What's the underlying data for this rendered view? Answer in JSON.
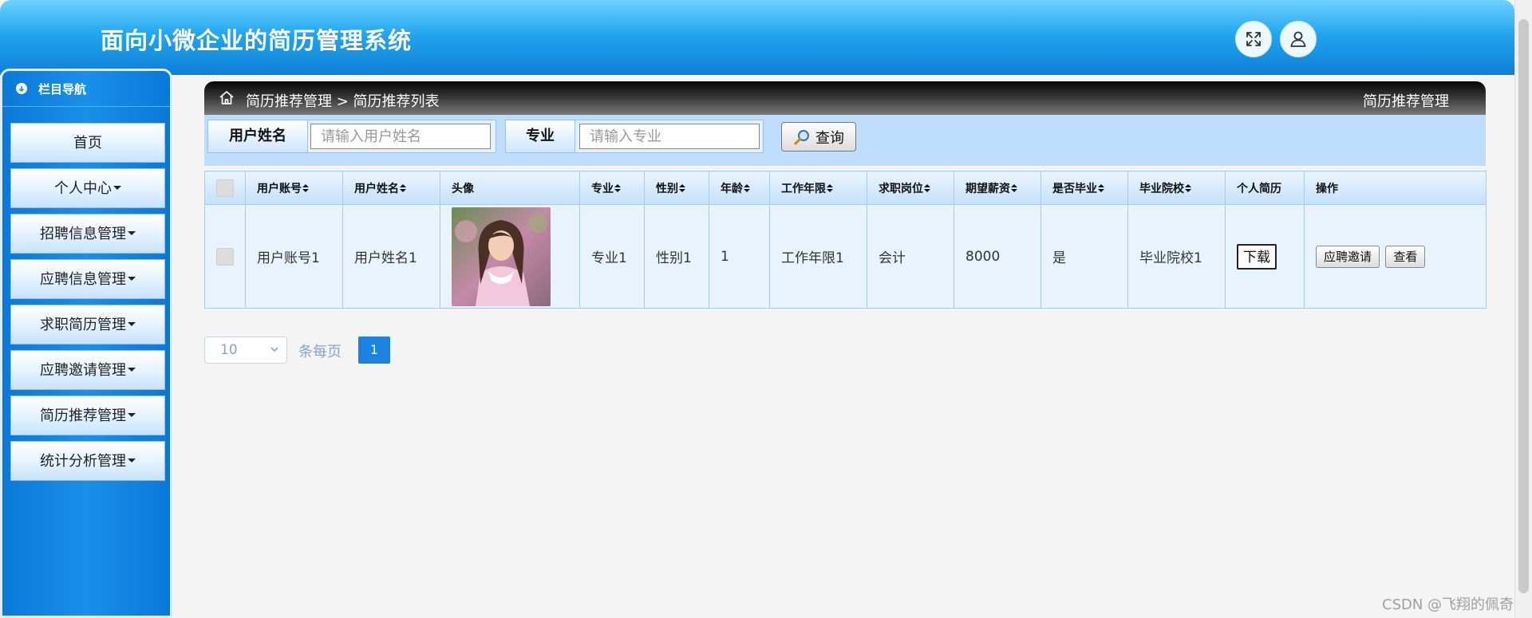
{
  "header": {
    "title": "面向小微企业的简历管理系统",
    "fullscreen_icon": "expand-icon",
    "user_icon": "user-icon"
  },
  "sidebar": {
    "nav_title": "栏目导航",
    "items": [
      {
        "label": "首页",
        "has_caret": false
      },
      {
        "label": "个人中心",
        "has_caret": true
      },
      {
        "label": "招聘信息管理",
        "has_caret": true
      },
      {
        "label": "应聘信息管理",
        "has_caret": true
      },
      {
        "label": "求职简历管理",
        "has_caret": true
      },
      {
        "label": "应聘邀请管理",
        "has_caret": true
      },
      {
        "label": "简历推荐管理",
        "has_caret": true
      },
      {
        "label": "统计分析管理",
        "has_caret": true
      }
    ]
  },
  "breadcrumb": {
    "path": "简历推荐管理 > 简历推荐列表",
    "right_title": "简历推荐管理"
  },
  "search": {
    "username_label": "用户姓名",
    "username_placeholder": "请输入用户姓名",
    "major_label": "专业",
    "major_placeholder": "请输入专业",
    "button_label": "查询"
  },
  "table": {
    "columns": [
      "用户账号",
      "用户姓名",
      "头像",
      "专业",
      "性别",
      "年龄",
      "工作年限",
      "求职岗位",
      "期望薪资",
      "是否毕业",
      "毕业院校",
      "个人简历",
      "操作"
    ],
    "rows": [
      {
        "account": "用户账号1",
        "name": "用户姓名1",
        "major": "专业1",
        "gender": "性别1",
        "age": "1",
        "work_years": "工作年限1",
        "position": "会计",
        "salary": "8000",
        "graduated": "是",
        "school": "毕业院校1",
        "resume_button": "下载",
        "invite_button": "应聘邀请",
        "view_button": "查看"
      }
    ]
  },
  "pagination": {
    "page_size": "10",
    "per_page_label": "条每页",
    "current_page": "1"
  },
  "watermark": "CSDN @飞翔的佩奇"
}
